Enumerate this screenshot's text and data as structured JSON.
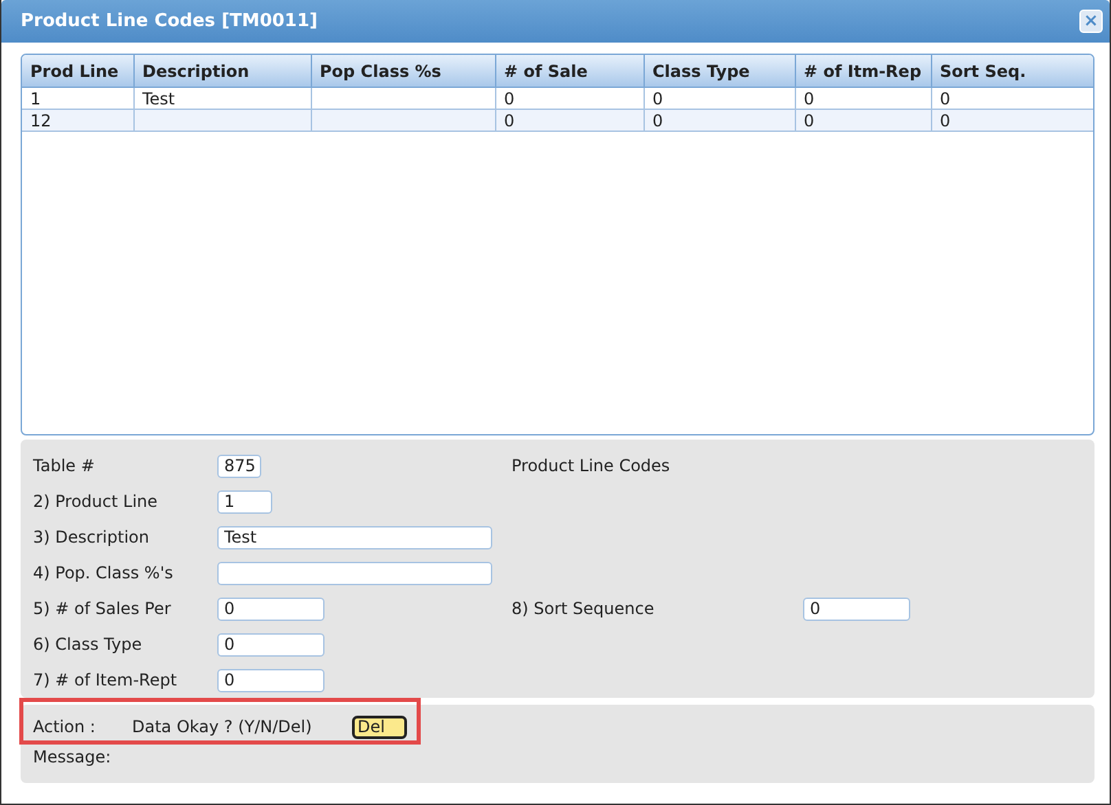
{
  "window": {
    "title": "Product Line Codes [TM0011]",
    "close": "×"
  },
  "table": {
    "columns": [
      "Prod Line",
      "Description",
      "Pop Class %s",
      "# of Sale",
      "Class Type",
      "# of Itm-Rep",
      "Sort Seq."
    ],
    "rows": [
      [
        "1",
        "Test",
        "",
        "0",
        "0",
        "0",
        "0"
      ],
      [
        "12",
        "",
        "",
        "0",
        "0",
        "0",
        "0"
      ]
    ]
  },
  "form": {
    "fields": [
      {
        "label": "Table #",
        "value": "875",
        "note": "Product Line Codes"
      },
      {
        "label": "2) Product Line",
        "value": "1"
      },
      {
        "label": "3) Description",
        "value": "Test"
      },
      {
        "label": "4) Pop. Class %'s"
      },
      {
        "label": "5) # of Sales Per",
        "value": "0",
        "side": {
          "label": "8) Sort Sequence",
          "value": "0"
        }
      },
      {
        "label": "6) Class Type",
        "value": "0"
      },
      {
        "label": "7) # of Item-Rept",
        "value": "0"
      }
    ]
  },
  "action": {
    "label": "Action :",
    "prompt": "Data Okay ? (Y/N/Del)",
    "value": "Del",
    "focused": true,
    "message_label": "Message:"
  }
}
